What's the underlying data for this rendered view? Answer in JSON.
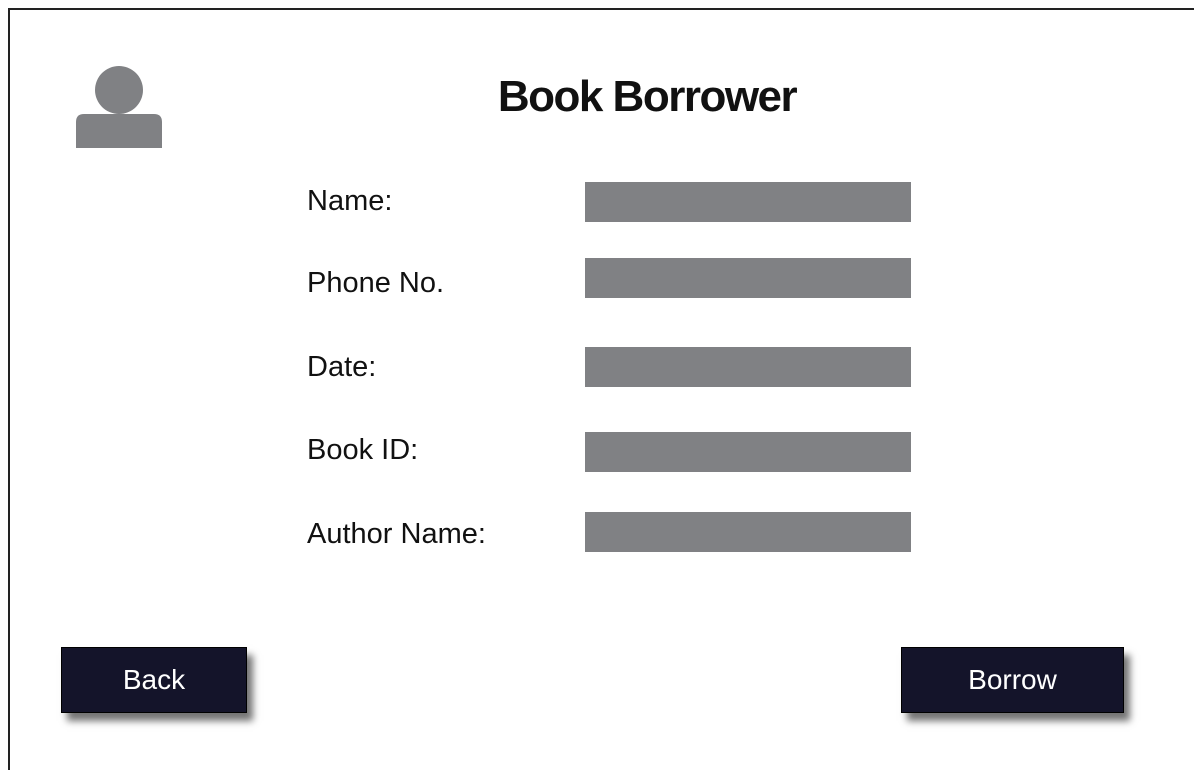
{
  "header": {
    "title": "Book Borrower",
    "avatar_icon": "user-icon"
  },
  "form": {
    "fields": [
      {
        "label": "Name:",
        "value": ""
      },
      {
        "label": "Phone No.",
        "value": ""
      },
      {
        "label": "Date:",
        "value": ""
      },
      {
        "label": "Book ID:",
        "value": ""
      },
      {
        "label": "Author Name:",
        "value": ""
      }
    ]
  },
  "actions": {
    "back_label": "Back",
    "borrow_label": "Borrow"
  },
  "colors": {
    "input_fill": "#808184",
    "button_fill": "#14142a",
    "avatar_fill": "#808184"
  }
}
